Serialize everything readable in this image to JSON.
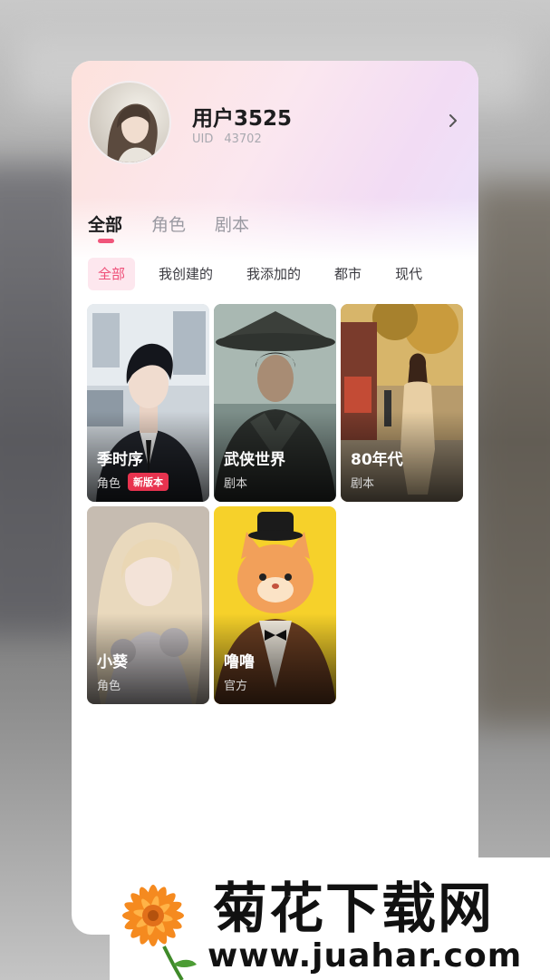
{
  "profile": {
    "username": "用户3525",
    "uid_label": "UID",
    "uid_value": "43702"
  },
  "tabs": [
    {
      "label": "全部",
      "active": true
    },
    {
      "label": "角色",
      "active": false
    },
    {
      "label": "剧本",
      "active": false
    }
  ],
  "filters": [
    {
      "label": "全部",
      "active": true
    },
    {
      "label": "我创建的",
      "active": false
    },
    {
      "label": "我添加的",
      "active": false
    },
    {
      "label": "都市",
      "active": false
    },
    {
      "label": "现代",
      "active": false
    }
  ],
  "cards": [
    {
      "name": "季时序",
      "type": "角色",
      "badge": "新版本"
    },
    {
      "name": "武侠世界",
      "type": "剧本"
    },
    {
      "name": "80年代",
      "type": "剧本"
    },
    {
      "name": "小葵",
      "type": "角色"
    },
    {
      "name": "噜噜",
      "type": "官方"
    }
  ],
  "watermark": {
    "title": "菊花下载网",
    "url": "www.juahar.com"
  },
  "colors": {
    "accent": "#ef4f78",
    "badge": "#e8334f",
    "header_gradient_start": "#fde2dc",
    "header_gradient_end": "#ece3fb"
  },
  "icons": {
    "header_arrow": "chevron-right-icon"
  }
}
